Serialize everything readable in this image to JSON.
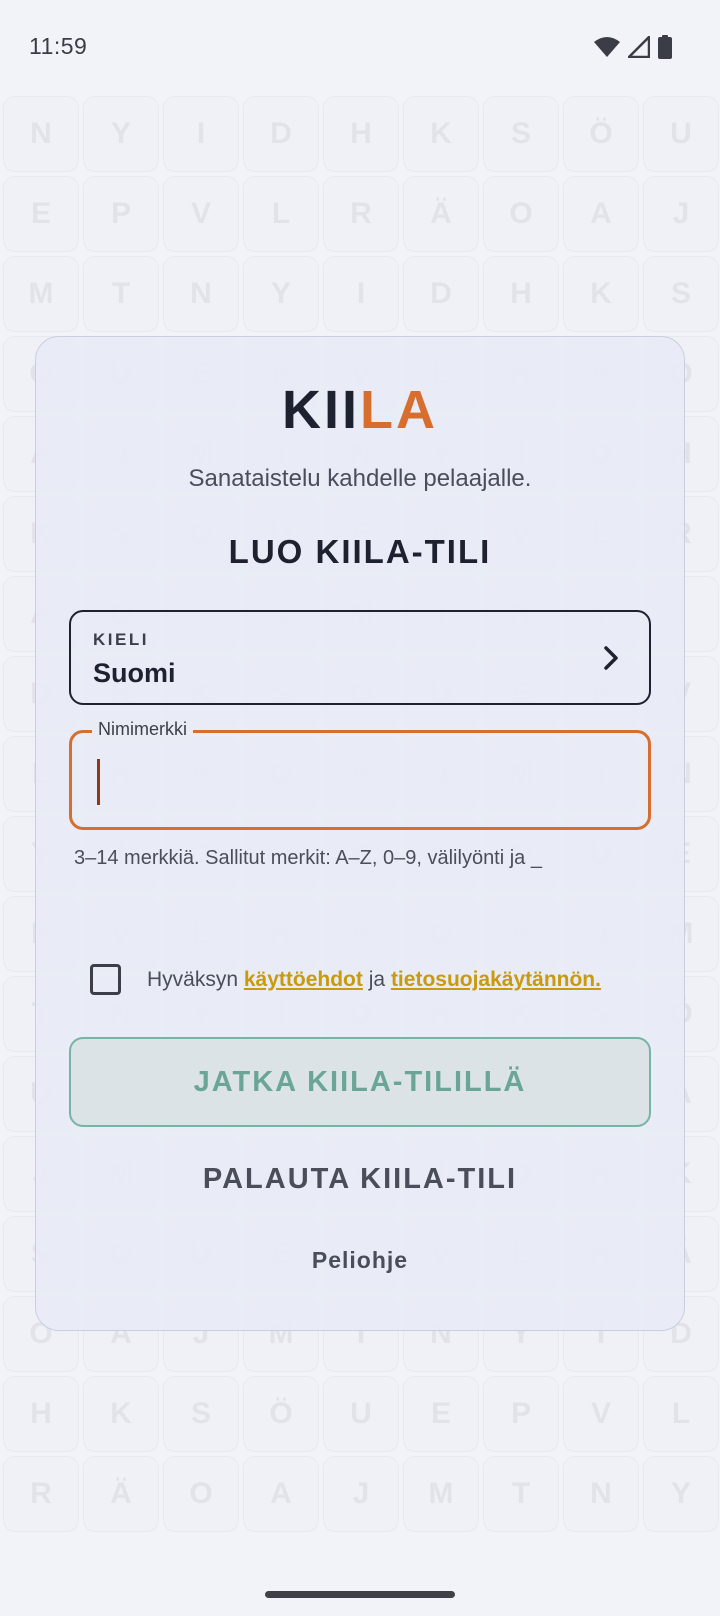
{
  "status_bar": {
    "time": "11:59"
  },
  "background_letters": [
    "N",
    "Y",
    "I",
    "D",
    "H",
    "K",
    "S",
    "Ö",
    "U",
    "E",
    "P",
    "V",
    "L",
    "R",
    "Ä",
    "O",
    "A",
    "J",
    "M",
    "T",
    "N",
    "Y",
    "I",
    "D",
    "H",
    "K",
    "S",
    "Ö",
    "U",
    "E",
    "P",
    "V",
    "L",
    "R",
    "Ä",
    "O",
    "A",
    "J",
    "M",
    "T",
    "N",
    "Y",
    "I",
    "D",
    "H",
    "K",
    "S",
    "Ö",
    "U",
    "E",
    "P",
    "V",
    "L",
    "R",
    "Ä",
    "O",
    "A",
    "J",
    "M",
    "T",
    "N",
    "Y",
    "I",
    "D",
    "H",
    "K",
    "S",
    "Ö",
    "U",
    "E",
    "P",
    "V",
    "L",
    "R",
    "Ä",
    "O",
    "A",
    "J",
    "M",
    "T",
    "N",
    "Y",
    "I",
    "D",
    "H",
    "K",
    "S",
    "Ö",
    "U",
    "E",
    "P",
    "V",
    "L",
    "R",
    "Ä",
    "O",
    "A",
    "J",
    "M",
    "T",
    "N",
    "Y",
    "I",
    "D",
    "H",
    "K",
    "S",
    "Ö",
    "U",
    "E",
    "P",
    "V",
    "L",
    "R",
    "Ä",
    "O",
    "A",
    "J",
    "M",
    "T",
    "N",
    "Y",
    "I",
    "D",
    "H",
    "K",
    "S",
    "Ö",
    "U",
    "E",
    "P",
    "V",
    "L",
    "R",
    "Ä",
    "O",
    "A",
    "J",
    "M",
    "T",
    "N",
    "Y",
    "I",
    "D",
    "H",
    "K",
    "S",
    "Ö",
    "U",
    "E",
    "P",
    "V",
    "L",
    "R",
    "Ä",
    "O",
    "A",
    "J",
    "M",
    "T",
    "N",
    "Y"
  ],
  "card": {
    "logo_part1": "KII",
    "logo_part2": "LA",
    "tagline": "Sanataistelu kahdelle pelaajalle.",
    "title": "LUO KIILA-TILI",
    "language": {
      "label": "KIELI",
      "value": "Suomi"
    },
    "nickname": {
      "label": "Nimimerkki",
      "value": ""
    },
    "hint": "3–14 merkkiä. Sallitut merkit: A–Z, 0–9, välilyönti ja _",
    "terms": {
      "prefix": "Hyväksyn",
      "link_terms": "käyttöehdot",
      "middle": "ja",
      "link_privacy": "tietosuojakäytännön."
    },
    "continue_label": "JATKA KIILA-TILILLÄ",
    "restore_label": "PALAUTA KIILA-TILI",
    "help_label": "Peliohje"
  },
  "colors": {
    "accent_orange": "#d56e2e",
    "link_gold": "#c99a0e",
    "continue_teal": "#6aa597",
    "text_dark": "#1e2230"
  }
}
